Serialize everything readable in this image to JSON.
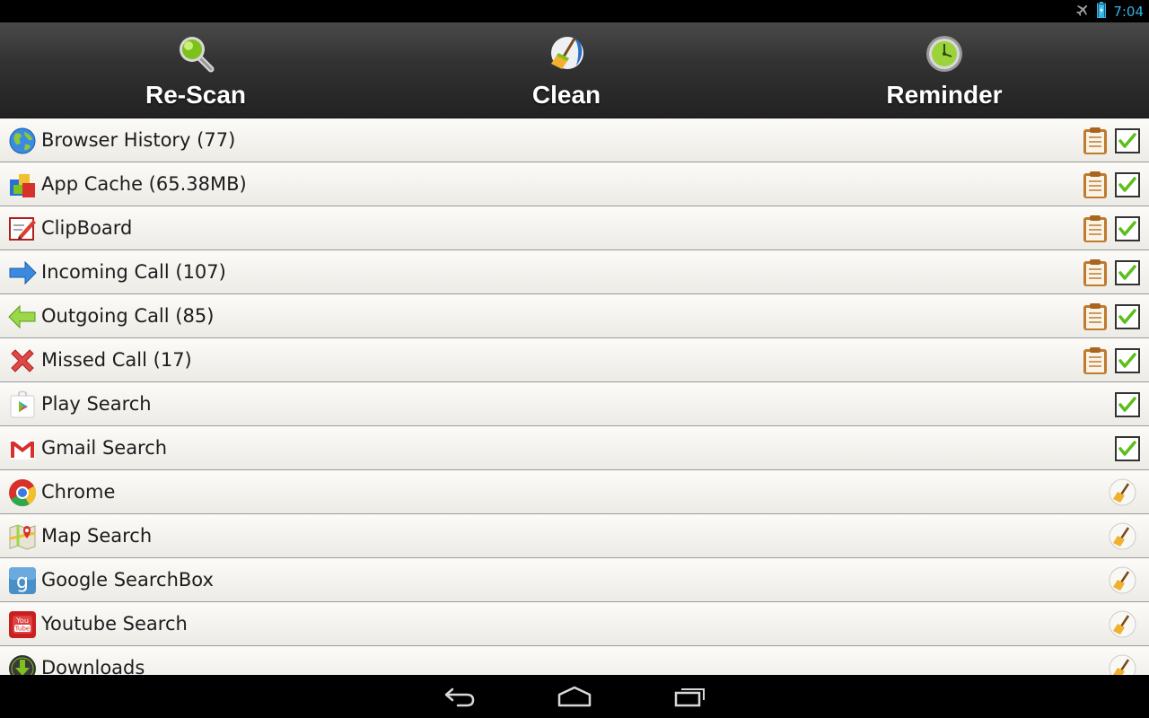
{
  "status_bar": {
    "time": "7:04",
    "icons": [
      "airplane-icon",
      "battery-charging-icon"
    ],
    "time_color": "#33b5e5"
  },
  "toolbar": {
    "rescan_label": "Re-Scan",
    "clean_label": "Clean",
    "reminder_label": "Reminder",
    "icons": [
      "magnifier-icon",
      "broom-icon",
      "clock-icon"
    ]
  },
  "list": {
    "items": [
      {
        "label": "Browser History (77)",
        "icon": "globe-icon",
        "details": true,
        "checked": true
      },
      {
        "label": "App Cache (65.38MB)",
        "icon": "app-cache-icon",
        "details": true,
        "checked": true
      },
      {
        "label": "ClipBoard",
        "icon": "clipboard-pencil-icon",
        "details": true,
        "checked": true
      },
      {
        "label": "Incoming Call (107)",
        "icon": "arrow-right-icon",
        "details": true,
        "checked": true
      },
      {
        "label": "Outgoing Call (85)",
        "icon": "arrow-left-icon",
        "details": true,
        "checked": true
      },
      {
        "label": "Missed Call (17)",
        "icon": "red-x-icon",
        "details": true,
        "checked": true
      },
      {
        "label": "Play Search",
        "icon": "play-store-icon",
        "details": false,
        "checked": true
      },
      {
        "label": "Gmail Search",
        "icon": "gmail-icon",
        "details": false,
        "checked": true
      },
      {
        "label": "Chrome",
        "icon": "chrome-icon",
        "details": false,
        "clean_button": true
      },
      {
        "label": "Map Search",
        "icon": "maps-icon",
        "details": false,
        "clean_button": true
      },
      {
        "label": "Google SearchBox",
        "icon": "google-search-icon",
        "details": false,
        "clean_button": true
      },
      {
        "label": "Youtube Search",
        "icon": "youtube-icon",
        "details": false,
        "clean_button": true
      },
      {
        "label": "Downloads",
        "icon": "download-icon",
        "details": false,
        "clean_button": true
      }
    ]
  },
  "nav_bar": {
    "buttons": [
      "back-icon",
      "home-icon",
      "recent-apps-icon"
    ]
  }
}
